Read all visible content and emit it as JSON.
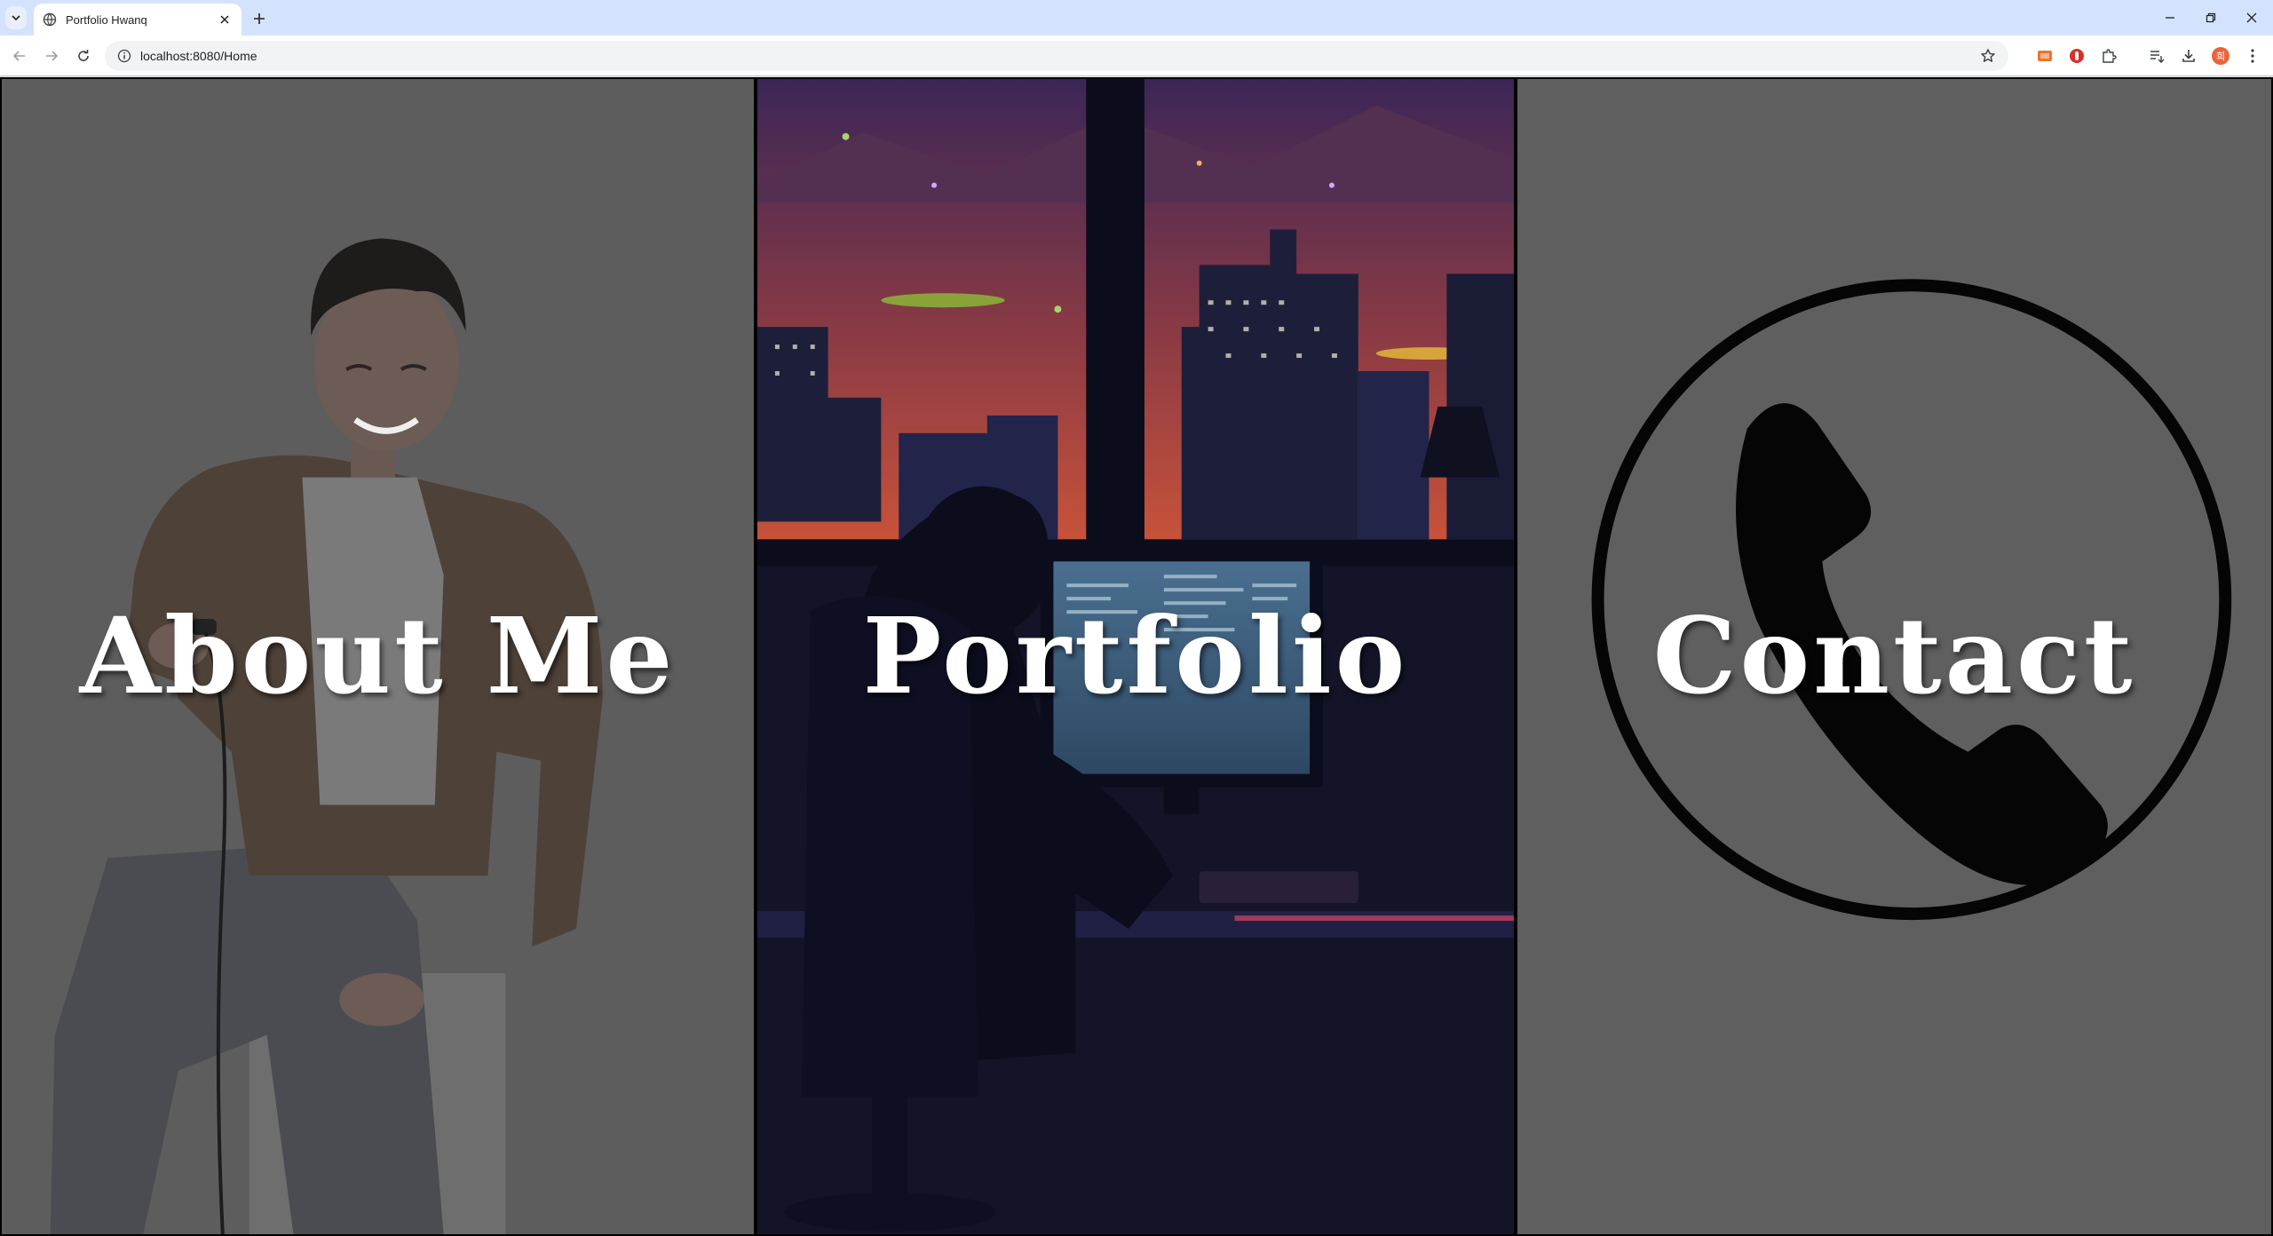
{
  "browser": {
    "tab_title": "Portfolio Hwanq",
    "url": "localhost:8080/Home",
    "profile_initials": "희"
  },
  "icons": {
    "tab_search": "chevron-down-icon",
    "favicon": "globe-icon",
    "tab_close": "close-icon",
    "new_tab": "plus-icon",
    "back": "back-arrow-icon",
    "forward": "forward-arrow-icon",
    "reload": "reload-icon",
    "site_info": "info-icon",
    "bookmark": "star-icon",
    "extensions": [
      "extension-orange-icon",
      "extension-red-icon",
      "puzzle-icon"
    ],
    "reading_list": "reading-list-icon",
    "downloads": "download-icon",
    "menu": "kebab-menu-icon"
  },
  "panels": {
    "about": {
      "label": "About Me"
    },
    "portfolio": {
      "label": "Portfolio"
    },
    "contact": {
      "label": "Contact"
    }
  },
  "colors": {
    "overlay": "#5e5e5e",
    "label": "#ffffff",
    "sky_top": "#3b2657",
    "sky_bottom": "#c7523a",
    "night": "#141428"
  }
}
